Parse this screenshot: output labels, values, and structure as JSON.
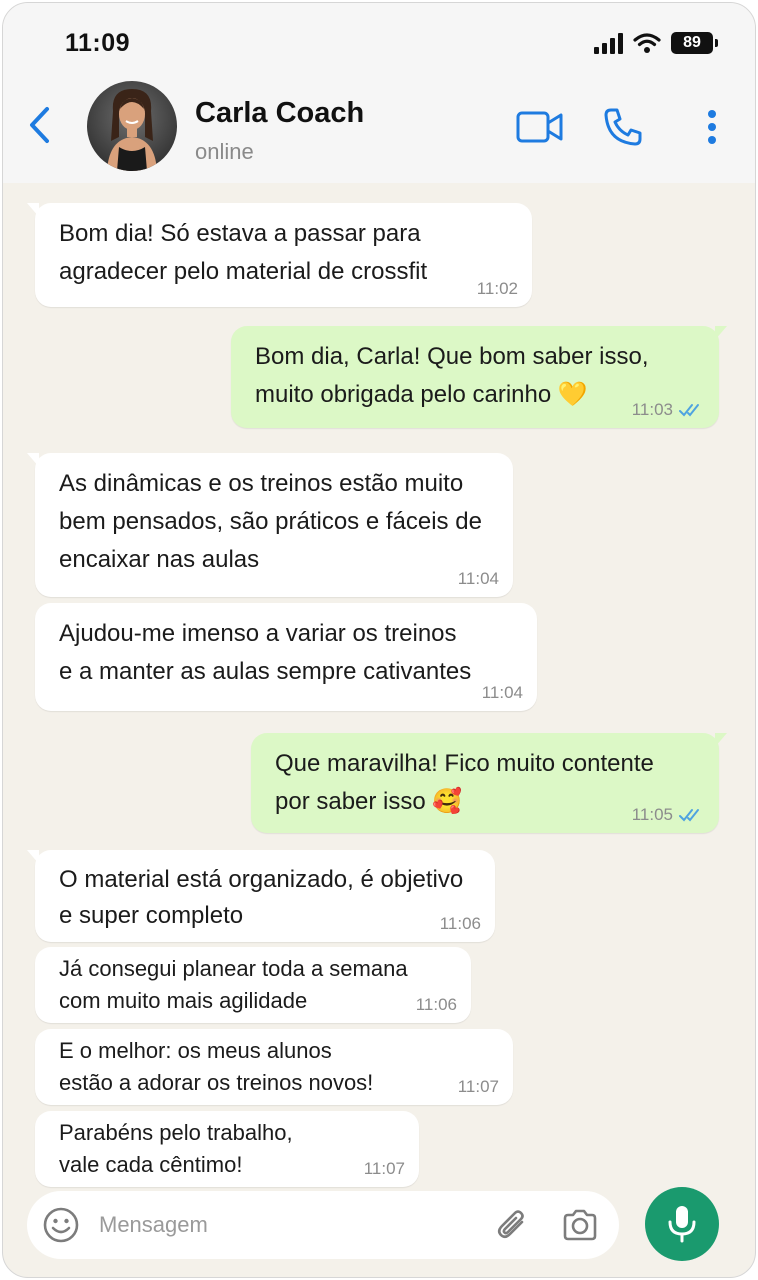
{
  "status_bar": {
    "time": "11:09",
    "battery": "89"
  },
  "header": {
    "contact_name": "Carla Coach",
    "contact_status": "online",
    "icons": [
      "back-icon",
      "video-call-icon",
      "phone-icon",
      "more-vertical-icon"
    ]
  },
  "messages": [
    {
      "direction": "in",
      "lines": [
        "Bom dia! Só estava a passar para",
        "agradecer pelo material de crossfit"
      ],
      "time": "11:02"
    },
    {
      "direction": "out",
      "lines": [
        "Bom dia, Carla! Que bom saber isso,",
        "muito obrigada pelo carinho 💛"
      ],
      "time": "11:03",
      "read": true
    },
    {
      "direction": "in",
      "lines": [
        "As dinâmicas e os treinos estão muito",
        "bem pensados, são práticos e fáceis de",
        "encaixar nas aulas"
      ],
      "time": "11:04"
    },
    {
      "direction": "in",
      "lines": [
        "Ajudou-me imenso a variar os treinos",
        "e a manter as aulas sempre cativantes"
      ],
      "time": "11:04"
    },
    {
      "direction": "out",
      "lines": [
        "Que maravilha! Fico muito contente",
        "por saber isso 🥰"
      ],
      "time": "11:05",
      "read": true
    },
    {
      "direction": "in",
      "lines": [
        "O material está organizado, é objetivo",
        "e super completo"
      ],
      "time": "11:06"
    },
    {
      "direction": "in",
      "lines": [
        "Já consegui planear toda a semana",
        "com muito mais agilidade"
      ],
      "time": "11:06"
    },
    {
      "direction": "in",
      "lines": [
        "E o melhor: os meus alunos",
        "estão a adorar os treinos novos!"
      ],
      "time": "11:07"
    },
    {
      "direction": "in",
      "lines": [
        "Parabéns pelo trabalho,",
        "vale cada cêntimo!"
      ],
      "time": "11:07"
    }
  ],
  "composer": {
    "placeholder": "Mensagem"
  },
  "colors": {
    "accent": "#1e7be0",
    "incoming_bubble": "#ffffff",
    "outgoing_bubble": "#dcf8c6",
    "chat_background": "#f4f1ea",
    "mic_button": "#1a9a6e",
    "read_ticks": "#4fa3e0"
  }
}
